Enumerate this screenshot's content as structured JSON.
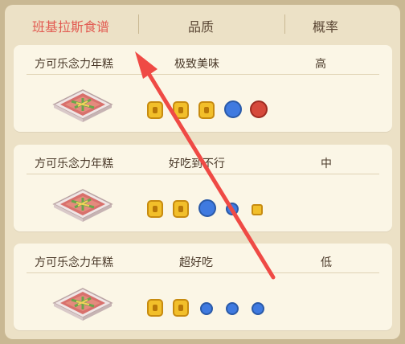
{
  "header": {
    "col1": "班基拉斯食谱",
    "col2": "品质",
    "col3": "概率"
  },
  "recipes": [
    {
      "name": "方可乐念力年糕",
      "quality": "极致美味",
      "probability": "高"
    },
    {
      "name": "方可乐念力年糕",
      "quality": "好吃到不行",
      "probability": "中"
    },
    {
      "name": "方可乐念力年糕",
      "quality": "超好吃",
      "probability": "低"
    }
  ],
  "colors": {
    "accent_red": "#e25b52",
    "card_bg": "#fbf6e6",
    "panel_bg": "#ece1c6",
    "annotation_arrow": "#ef4a45"
  },
  "icons": {
    "dish": "nian-gao-dish-icon",
    "ingredients": [
      "yellow-berry-icon",
      "blue-mushroom-icon",
      "red-berry-icon",
      "small-blue-berry-icon",
      "small-yellow-item-icon"
    ]
  }
}
